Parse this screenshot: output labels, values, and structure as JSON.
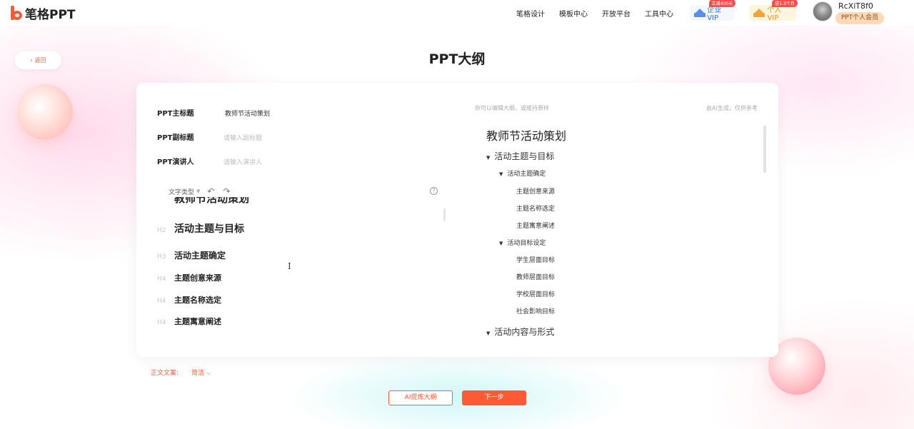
{
  "brand": {
    "name": "笔格PPT",
    "accent": "#ff5a36"
  },
  "nav": [
    "笔格设计",
    "模板中心",
    "开放平台",
    "工具中心"
  ],
  "vip": {
    "enterprise": {
      "label": "企业VIP",
      "tag": "立减400元"
    },
    "personal": {
      "label": "个人VIP",
      "tag": "送1-3个月"
    }
  },
  "user": {
    "name": "RcXiT8f0",
    "badge": "PPT个人会员",
    "avatar_icon": "avatar-image"
  },
  "back": {
    "label": "返回"
  },
  "page_title": "PPT大纲",
  "form": {
    "title_label": "PPT主标题",
    "title_value": "教师节活动策划",
    "subtitle_label": "PPT副标题",
    "subtitle_placeholder": "请输入副标题",
    "speaker_label": "PPT演讲人",
    "speaker_placeholder": "请输入演讲人"
  },
  "toolbar": {
    "text_type": "文字类型"
  },
  "editor": {
    "cut_top_line": "教师节活动策划",
    "lines": [
      {
        "level": "H2",
        "text": "活动主题与目标"
      },
      {
        "level": "H3",
        "text": "活动主题确定"
      },
      {
        "level": "H4",
        "text": "主题创意来源"
      },
      {
        "level": "H4",
        "text": "主题名称选定"
      },
      {
        "level": "H4",
        "text": "主题寓意阐述"
      }
    ]
  },
  "hints": {
    "left": "你可以编辑大纲，或维持原样",
    "right": "由AI生成，仅供参考"
  },
  "preview": {
    "title": "教师节活动策划",
    "nodes": [
      {
        "text": "活动主题与目标",
        "level": 1,
        "arrow": true
      },
      {
        "text": "活动主题确定",
        "level": 2,
        "arrow": true
      },
      {
        "text": "主题创意来源",
        "level": 3,
        "arrow": false
      },
      {
        "text": "主题名称选定",
        "level": 3,
        "arrow": false
      },
      {
        "text": "主题寓意阐述",
        "level": 3,
        "arrow": false
      },
      {
        "text": "活动目标设定",
        "level": 2,
        "arrow": true
      },
      {
        "text": "学生层面目标",
        "level": 3,
        "arrow": false
      },
      {
        "text": "教师层面目标",
        "level": 3,
        "arrow": false
      },
      {
        "text": "学校层面目标",
        "level": 3,
        "arrow": false
      },
      {
        "text": "社会影响目标",
        "level": 3,
        "arrow": false
      },
      {
        "text": "活动内容与形式",
        "level": 1,
        "arrow": true
      }
    ]
  },
  "doc_style": {
    "label": "正文文案:",
    "value": "简洁"
  },
  "buttons": {
    "ai_refine": "AI提炼大纲",
    "next": "下一步"
  }
}
